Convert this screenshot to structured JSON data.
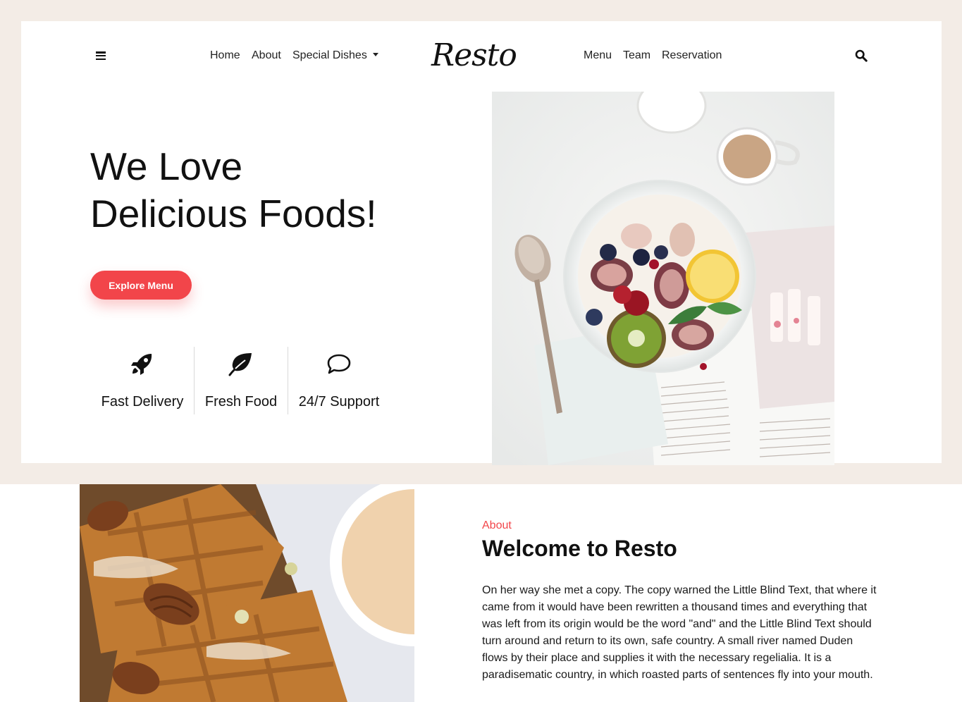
{
  "nav": {
    "left_links": [
      "Home",
      "About",
      "Special Dishes"
    ],
    "logo": "Resto",
    "right_links": [
      "Menu",
      "Team",
      "Reservation"
    ],
    "menu_icon": "hamburger-icon",
    "search_icon": "search-icon"
  },
  "hero": {
    "title_line1": "We Love",
    "title_line2": "Delicious Foods!",
    "cta_label": "Explore Menu",
    "features": [
      {
        "icon": "rocket-icon",
        "label": "Fast Delivery"
      },
      {
        "icon": "leaf-icon",
        "label": "Fresh Food"
      },
      {
        "icon": "speech-bubble-icon",
        "label": "24/7 Support"
      }
    ]
  },
  "about": {
    "kicker": "About",
    "title": "Welcome to Resto",
    "text": "On her way she met a copy. The copy warned the Little Blind Text, that where it came from it would have been rewritten a thousand times and everything that was left from its origin would be the word \"and\" and the Little Blind Text should turn around and return to its own, safe country. A small river named Duden flows by their place and supplies it with the necessary regelialia. It is a paradisematic country, in which roasted parts of sentences fly into your mouth."
  },
  "colors": {
    "accent": "#f2454a",
    "band": "#f3ece6",
    "text": "#111111"
  }
}
